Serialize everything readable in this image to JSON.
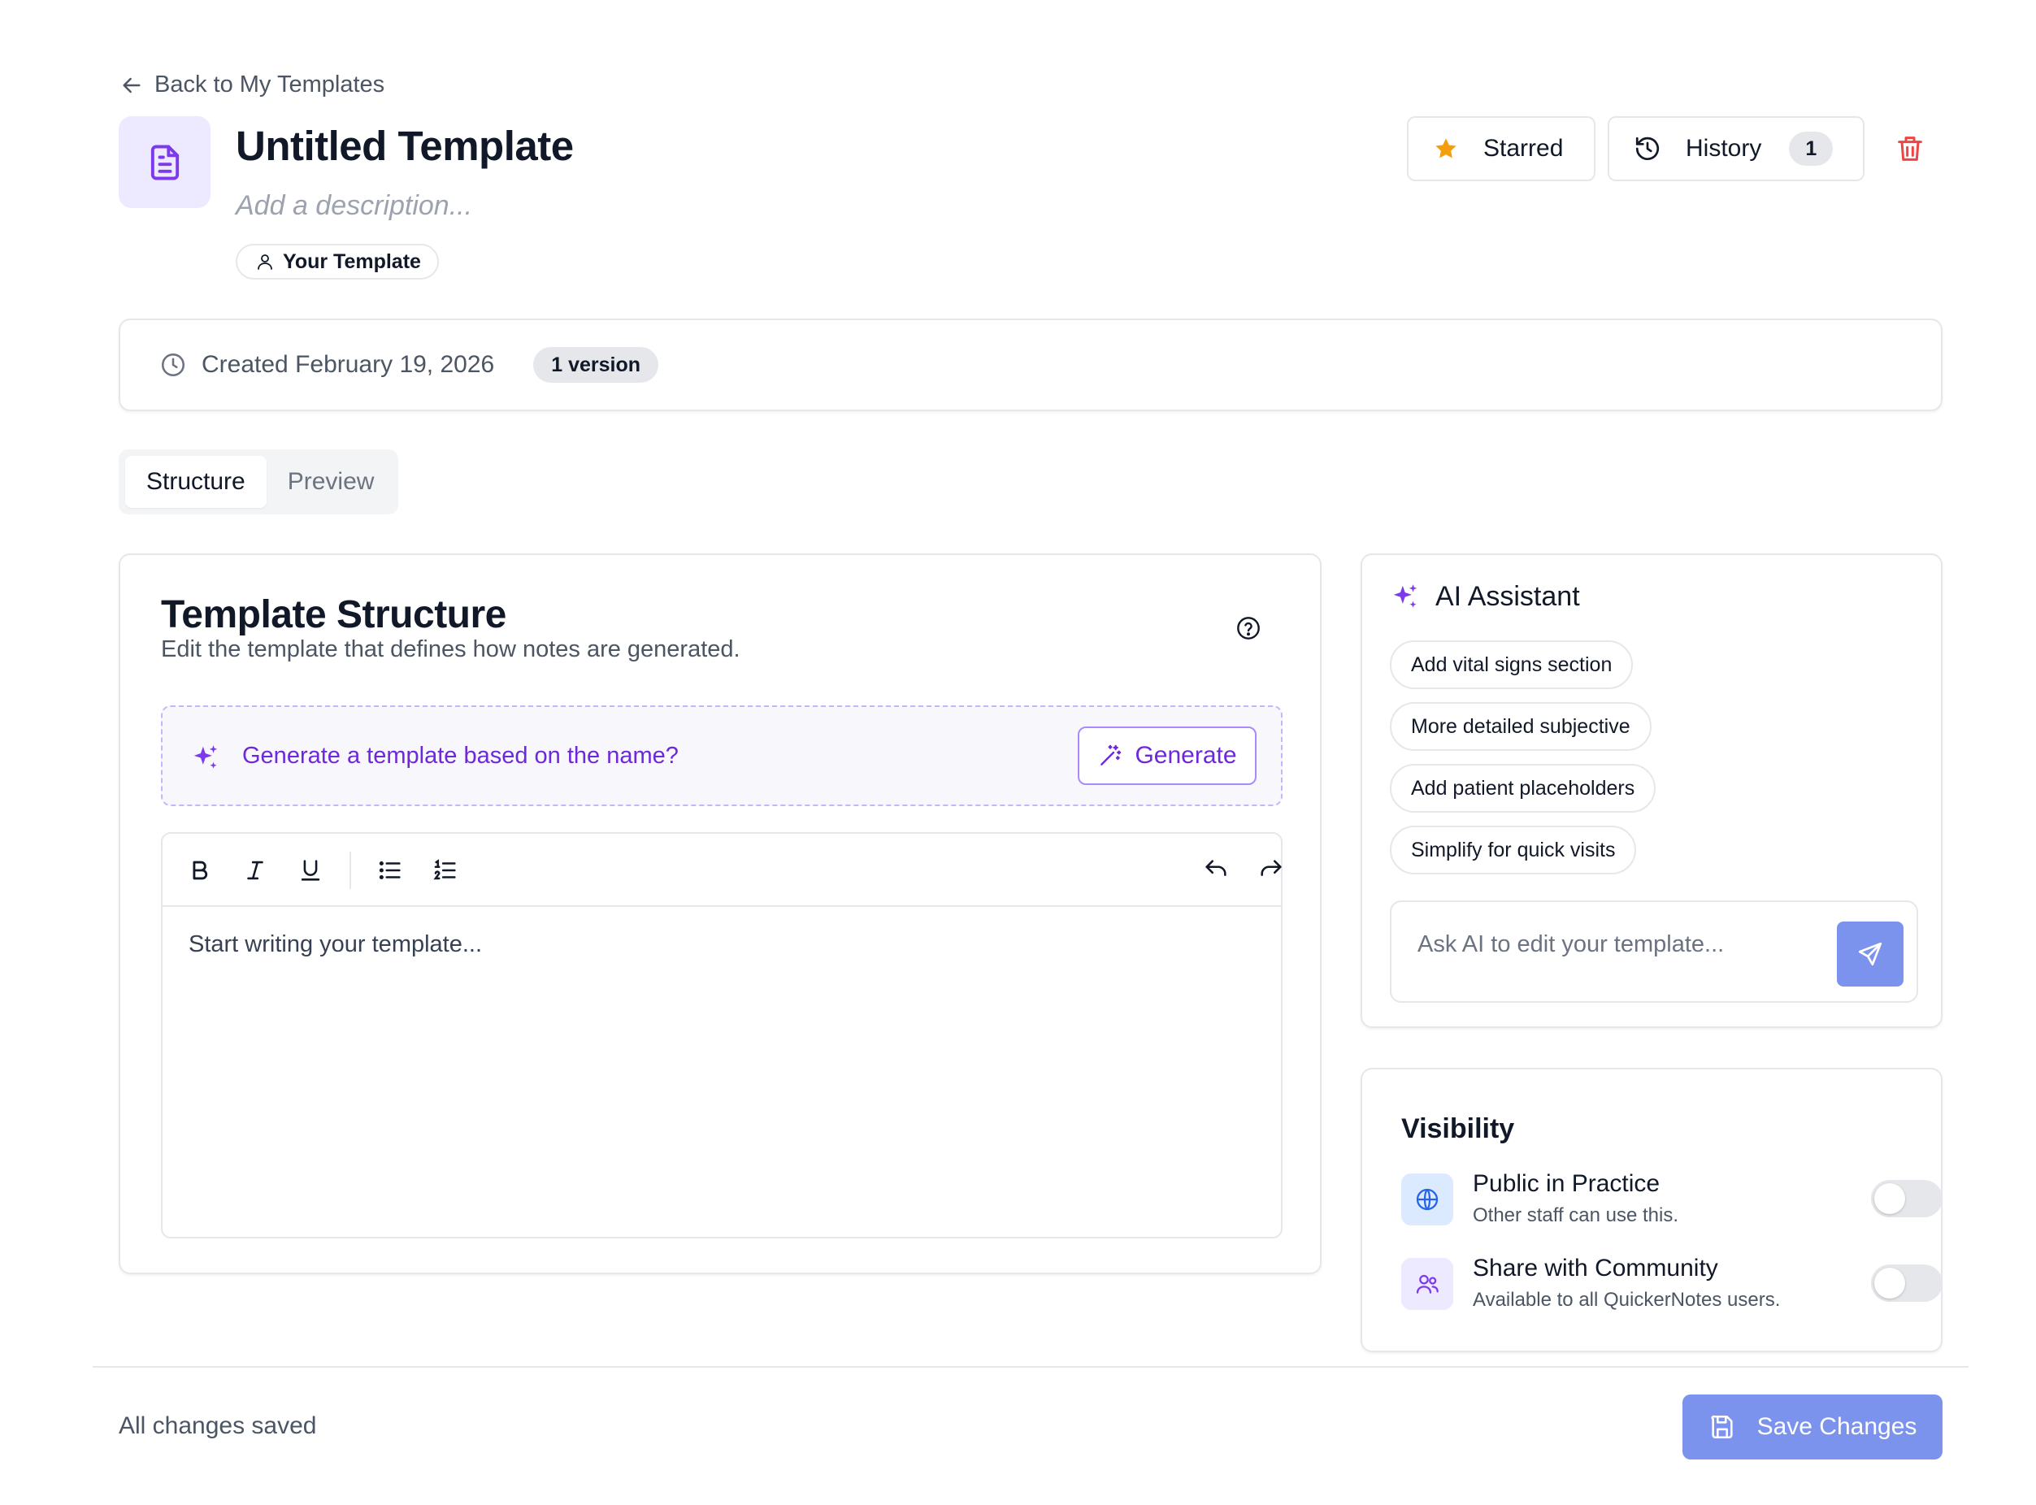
{
  "nav": {
    "back_label": "Back to My Templates"
  },
  "header": {
    "title": "Untitled Template",
    "description_placeholder": "Add a description...",
    "owner_label": "Your Template",
    "starred_label": "Starred",
    "history_label": "History",
    "history_count": "1"
  },
  "info": {
    "created": "Created February 19, 2026",
    "versions": "1 version"
  },
  "tabs": [
    {
      "label": "Structure",
      "active": true
    },
    {
      "label": "Preview",
      "active": false
    }
  ],
  "structure": {
    "title": "Template Structure",
    "subtitle": "Edit the template that defines how notes are generated.",
    "generate_prompt": "Generate a template based on the name?",
    "generate_label": "Generate",
    "editor_placeholder": "Start writing your template..."
  },
  "ai": {
    "title": "AI Assistant",
    "suggestions": [
      "Add vital signs section",
      "More detailed subjective",
      "Add patient placeholders",
      "Simplify for quick visits"
    ],
    "input_placeholder": "Ask AI to edit your template..."
  },
  "visibility": {
    "title": "Visibility",
    "options": [
      {
        "name": "Public in Practice",
        "desc": "Other staff can use this.",
        "enabled": false
      },
      {
        "name": "Share with Community",
        "desc": "Available to all QuickerNotes users.",
        "enabled": false
      }
    ]
  },
  "footer": {
    "status": "All changes saved",
    "save_label": "Save Changes"
  },
  "colors": {
    "accent": "#7c3aed",
    "primary_button": "#7b93ed",
    "star": "#f59e0b",
    "danger": "#ef4444"
  }
}
